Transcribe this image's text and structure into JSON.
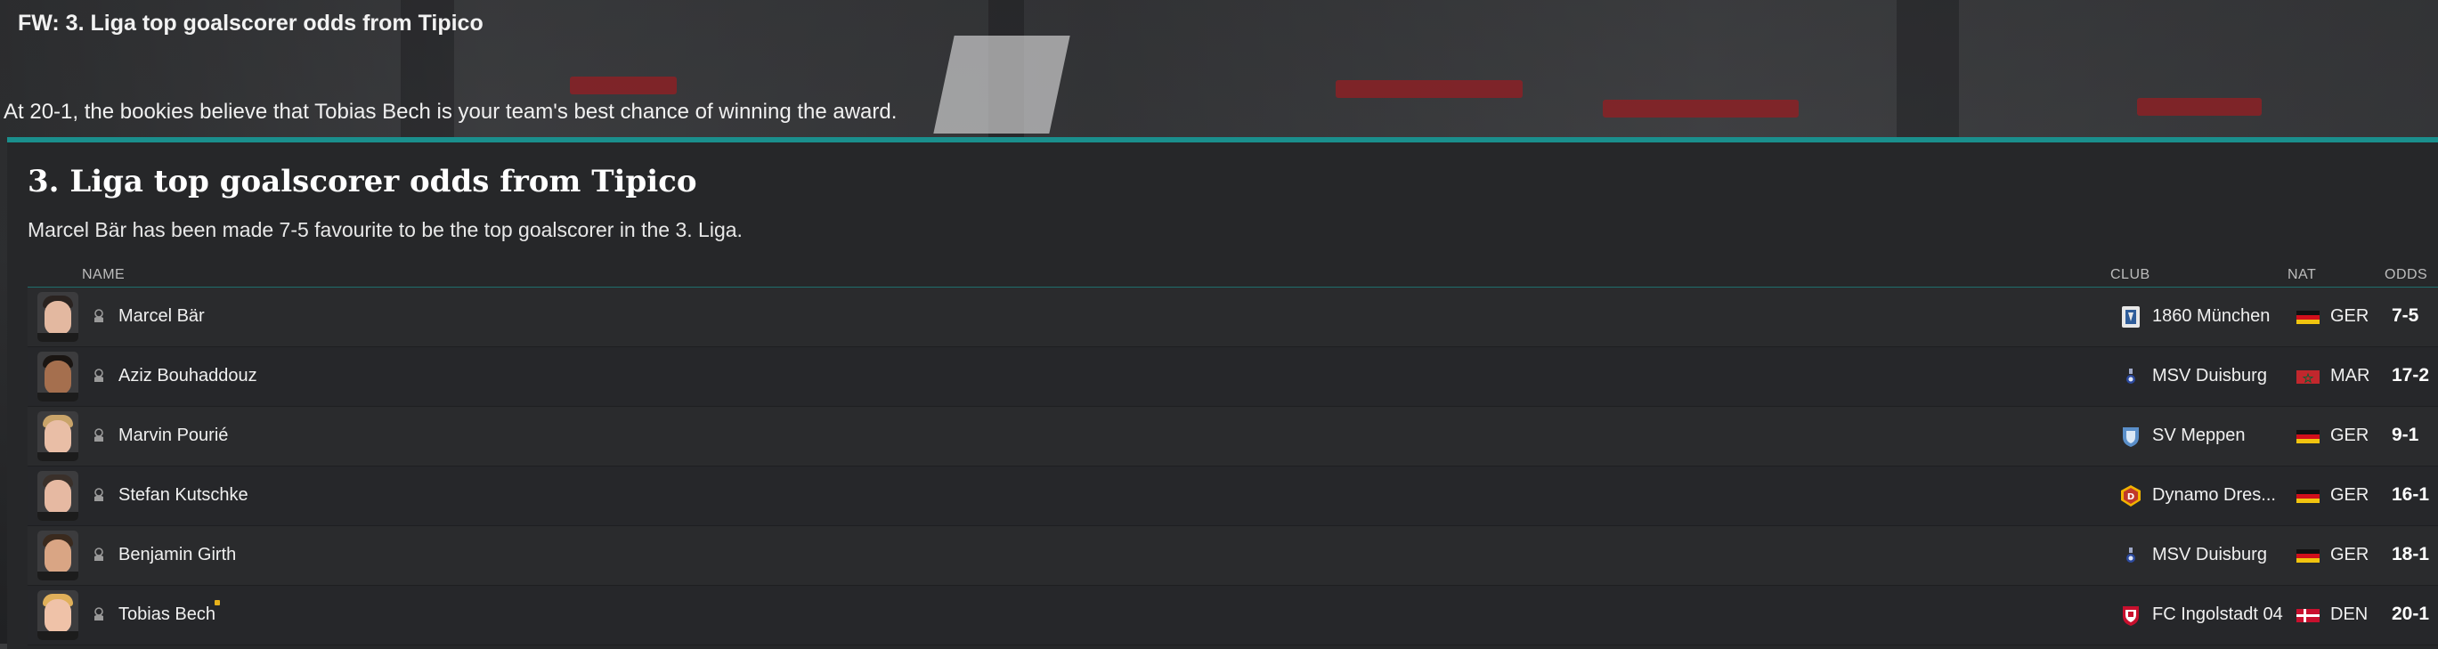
{
  "header": {
    "title": "FW: 3. Liga top goalscorer odds from Tipico",
    "summary": "At 20-1, the bookies believe that Tobias Bech is your team's best chance of winning the award."
  },
  "panel": {
    "title": "3. Liga top goalscorer odds from Tipico",
    "subtitle": "Marcel Bär has been made 7-5 favourite to be the top goalscorer in the 3. Liga.",
    "accent_color": "#1a8f8d",
    "columns": {
      "name": "NAME",
      "club": "CLUB",
      "nat": "NAT",
      "odds": "ODDS"
    },
    "rows": [
      {
        "name": "Marcel Bär",
        "club": "1860 München",
        "nat": "GER",
        "odds": "7-5",
        "flag": "germany",
        "badge": "1860-munchen-badge",
        "skin": "#e3b8a0",
        "hair": "#2a2320"
      },
      {
        "name": "Aziz Bouhaddouz",
        "club": "MSV Duisburg",
        "nat": "MAR",
        "odds": "17-2",
        "flag": "morocco",
        "badge": "msv-duisburg-badge",
        "skin": "#a56f4e",
        "hair": "#1a1512"
      },
      {
        "name": "Marvin Pourié",
        "club": "SV Meppen",
        "nat": "GER",
        "odds": "9-1",
        "flag": "germany",
        "badge": "sv-meppen-badge",
        "skin": "#e9bea6",
        "hair": "#c9a46a"
      },
      {
        "name": "Stefan Kutschke",
        "club": "Dynamo Dres...",
        "nat": "GER",
        "odds": "16-1",
        "flag": "germany",
        "badge": "dynamo-dresden-badge",
        "skin": "#e6b9a2",
        "hair": "#3a302a"
      },
      {
        "name": "Benjamin Girth",
        "club": "MSV Duisburg",
        "nat": "GER",
        "odds": "18-1",
        "flag": "germany",
        "badge": "msv-duisburg-badge",
        "skin": "#d9a584",
        "hair": "#3a2a1e"
      },
      {
        "name": "Tobias Bech",
        "club": "FC Ingolstadt 04",
        "nat": "DEN",
        "odds": "20-1",
        "flag": "denmark",
        "badge": "fc-ingolstadt-badge",
        "skin": "#efc2a8",
        "hair": "#e0b05a",
        "starred": true
      }
    ]
  }
}
